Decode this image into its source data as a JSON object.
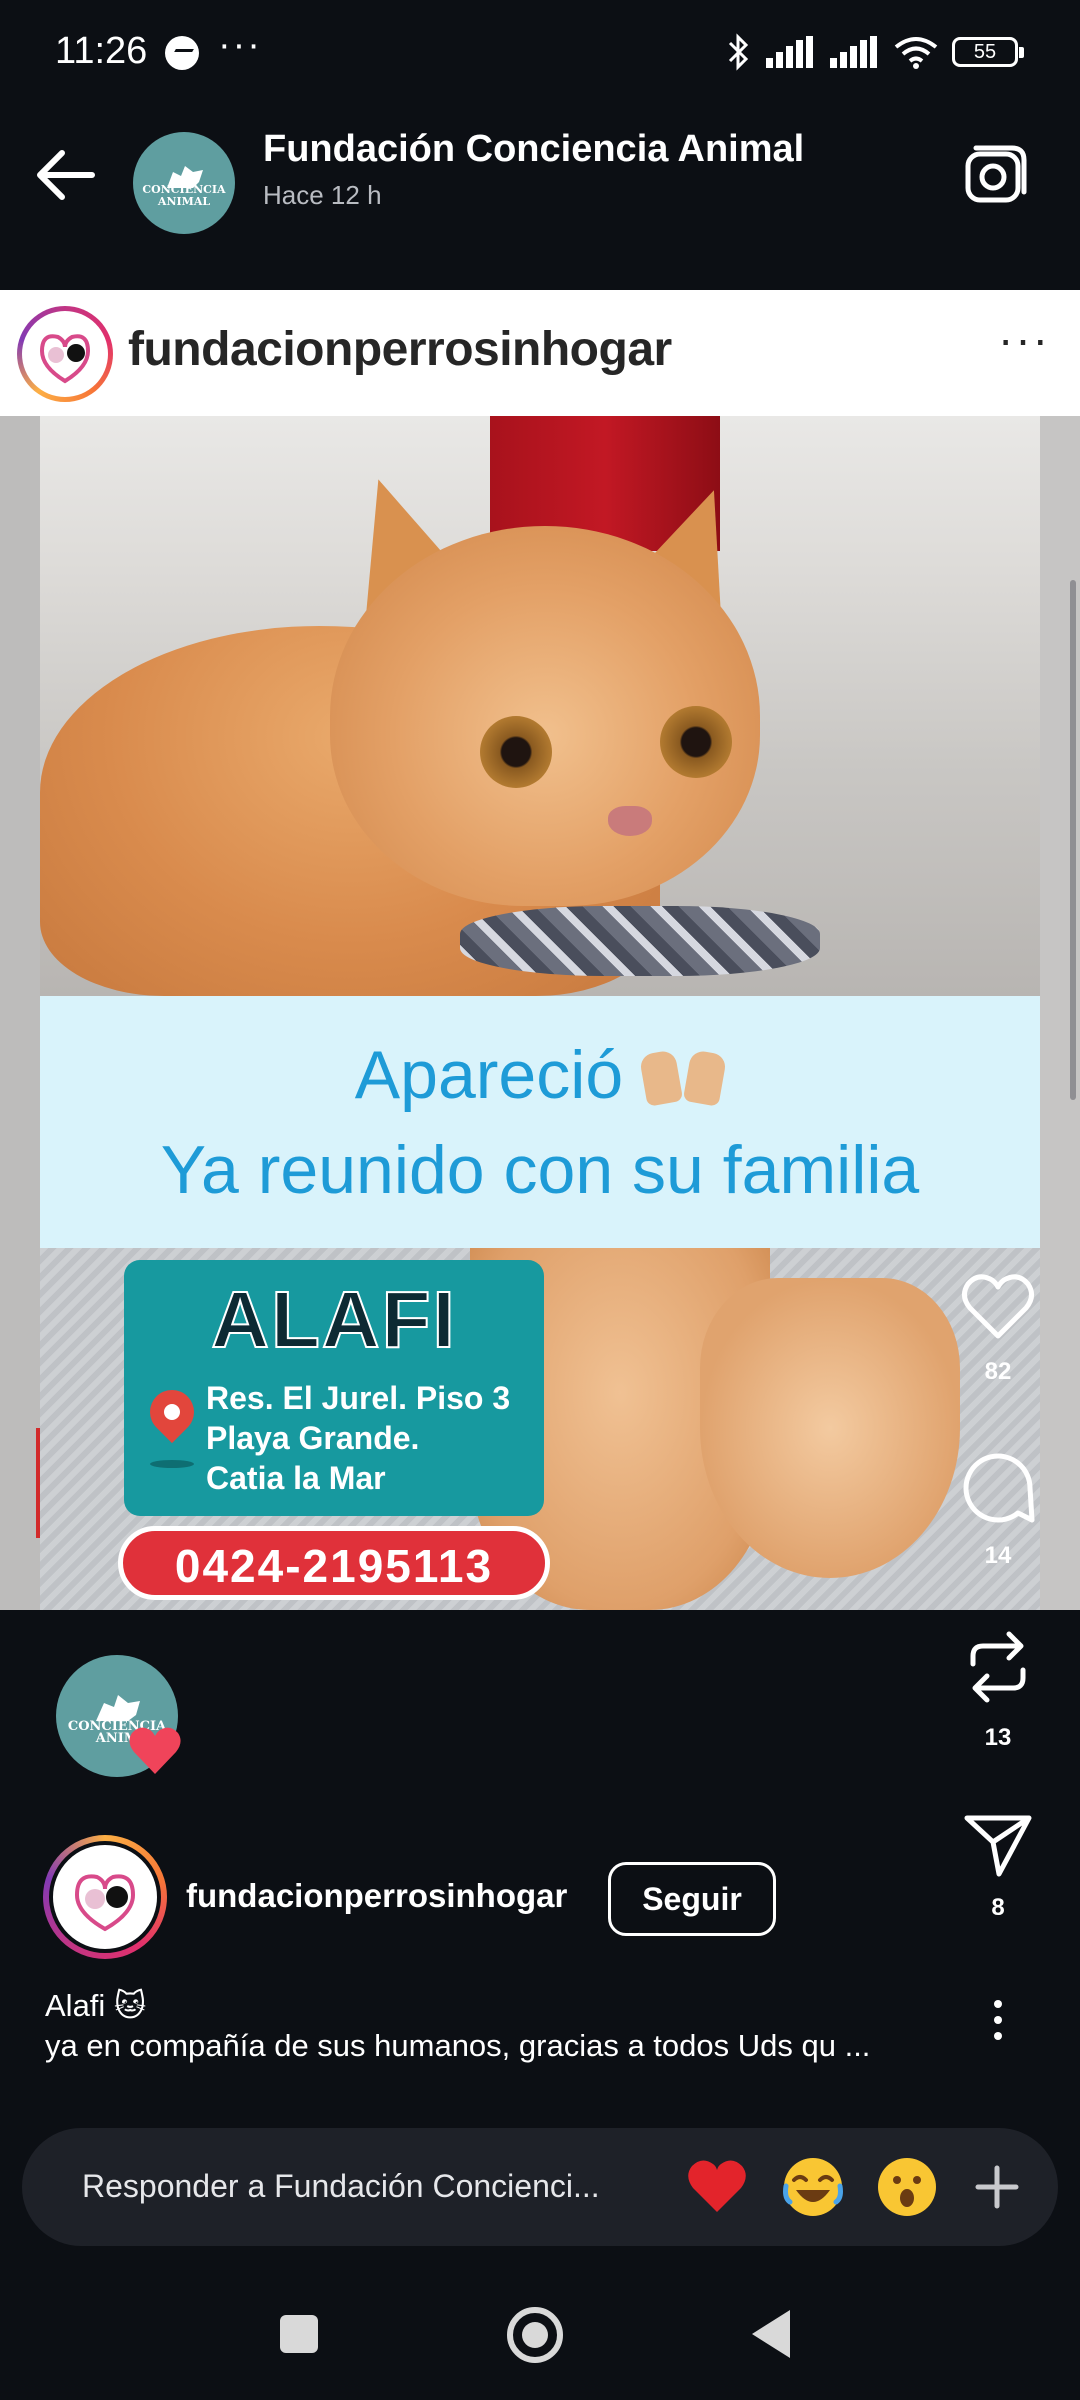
{
  "status_bar": {
    "time": "11:26",
    "dots": "···",
    "battery": "55"
  },
  "story_header": {
    "account_name": "Fundación Conciencia Animal",
    "time_ago": "Hace 12 h",
    "avatar_label": "CONCIENCIA ANIMAL"
  },
  "post": {
    "username": "fundacionperrosinhogar",
    "more": "···",
    "banner_line1": "Apareció",
    "banner_line2": "Ya reunido con su familia",
    "pet_name": "ALAFI",
    "address_lines": [
      "Res. El Jurel. Piso 3",
      "Playa Grande.",
      "Catia la Mar"
    ],
    "phone": "0424-2195113"
  },
  "actions": {
    "likes": "82",
    "comments": "14",
    "reposts": "13",
    "shares": "8"
  },
  "reaction_avatar_label": "CONCIENCIA ANIM",
  "author": {
    "username": "fundacionperrosinhogar",
    "follow_label": "Seguir"
  },
  "caption": {
    "title": "Alafi 🐱",
    "body": "ya en compañía de sus humanos, gracias a todos Uds qu ..."
  },
  "reply": {
    "placeholder": "Responder a Fundación Concienci..."
  },
  "colors": {
    "background": "#0c0f14",
    "banner_bg": "#d9f3fb",
    "banner_text": "#1e9bd7",
    "info_card": "#17999f",
    "phone_pill": "#e0313a",
    "avatar_teal": "#5f9ea0"
  }
}
